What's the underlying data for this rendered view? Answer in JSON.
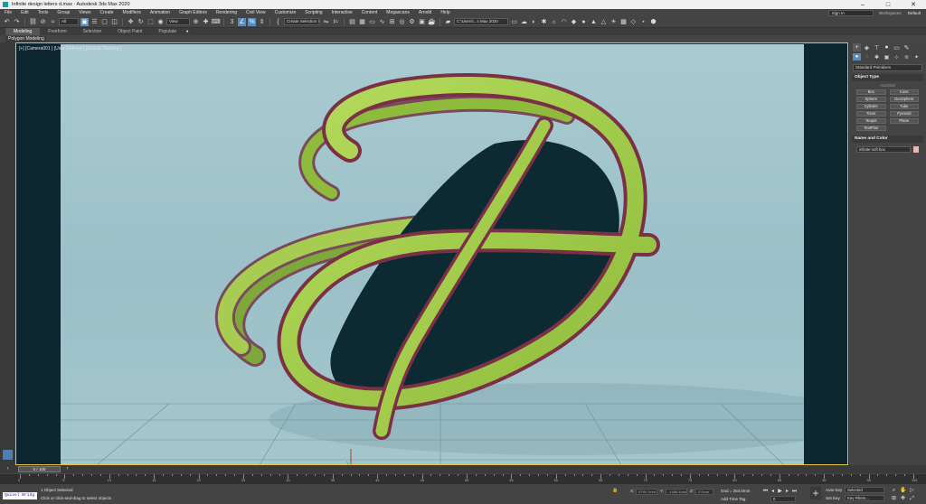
{
  "window": {
    "title": "Infinite design letters d.max - Autodesk 3ds Max 2020",
    "controls": [
      "–",
      "□",
      "✕"
    ]
  },
  "menu": {
    "items": [
      "File",
      "Edit",
      "Tools",
      "Group",
      "Views",
      "Create",
      "Modifiers",
      "Animation",
      "Graph Editors",
      "Rendering",
      "Civil View",
      "Customize",
      "Scripting",
      "Interactive",
      "Content",
      "Megascans",
      "Arnold",
      "Help"
    ],
    "sign_in": "Sign In",
    "workspaces_label": "Workspaces:",
    "workspaces_value": "Default"
  },
  "toolbar": {
    "filter_dropdown": "All",
    "ref_coord_dropdown": "View",
    "selection_set_dropdown": "Create Selection Se",
    "path_dropdown": "C:\\Users\\...s Max 2020"
  },
  "ribbon": {
    "tabs": [
      "Modeling",
      "Freeform",
      "Selection",
      "Object Paint",
      "Populate"
    ],
    "sub_label": "Polygon Modeling"
  },
  "viewport": {
    "label": "[+] [Camera001 ] [User Defined ] [Default Shading ]"
  },
  "command_panel": {
    "category_dropdown": "Standard Primitives",
    "object_type_title": "Object Type",
    "autogrid": "AutoGrid",
    "primitives": [
      "Box",
      "Cone",
      "Sphere",
      "GeoSphere",
      "Cylinder",
      "Tube",
      "Torus",
      "Pyramid",
      "Teapot",
      "Plane",
      "TextPlus"
    ],
    "name_color_title": "Name and Color",
    "object_name": "infinite-soft box",
    "swatch_color": "#e9b7b0"
  },
  "timeline": {
    "slider_label": "0 / 100",
    "ticks": [
      "0",
      "5",
      "10",
      "15",
      "20",
      "25",
      "30",
      "35",
      "40",
      "45",
      "50",
      "55",
      "60",
      "65",
      "70",
      "75",
      "80",
      "85",
      "90",
      "95",
      "100"
    ]
  },
  "status": {
    "maxscript": "Quixel Bridg",
    "selected_text": "1 Object Selected",
    "prompt_text": "Click or click-and-drag to select objects",
    "x_label": "X:",
    "y_label": "Y:",
    "z_label": "Z:",
    "x_value": "5790.7mm",
    "y_value": "-1488.4mm",
    "z_value": "0.0mm",
    "grid_text": "Grid = 254.0mm",
    "add_time_tag": "Add Time Tag",
    "auto_key": "Auto Key",
    "set_key": "Set Key",
    "selected_dropdown": "Selected",
    "key_filters": "Key Filters...",
    "frame_value": "0"
  }
}
